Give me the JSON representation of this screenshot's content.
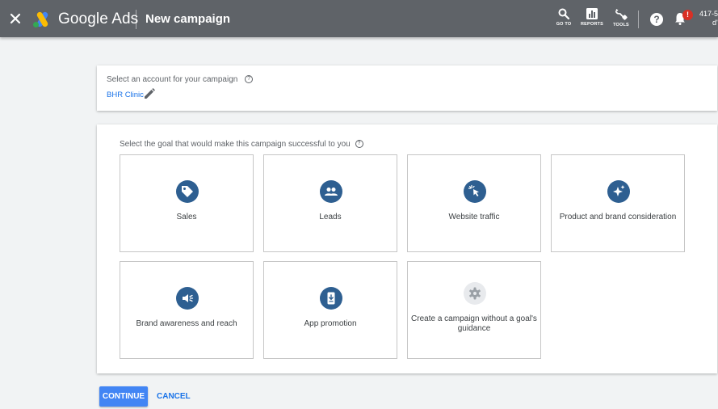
{
  "header": {
    "brand": "Google Ads",
    "title": "New campaign",
    "tools": [
      {
        "icon": "search-icon",
        "label": "GO TO"
      },
      {
        "icon": "reports-icon",
        "label": "REPORTS"
      },
      {
        "icon": "wrench-icon",
        "label": "TOOLS"
      }
    ],
    "help_glyph": "?",
    "notification_count": "!",
    "account_line1": "417-5",
    "account_line2": "d'"
  },
  "account_section": {
    "label": "Select an account for your campaign",
    "help_glyph": "?",
    "account_name": "BHR Clinic"
  },
  "goals_section": {
    "prompt": "Select the goal that would make this campaign successful to you",
    "help_glyph": "?",
    "goals": [
      {
        "label": "Sales",
        "icon": "tag-icon"
      },
      {
        "label": "Leads",
        "icon": "people-icon"
      },
      {
        "label": "Website traffic",
        "icon": "cursor-click-icon"
      },
      {
        "label": "Product and brand consideration",
        "icon": "sparkle-icon"
      },
      {
        "label": "Brand awareness and reach",
        "icon": "speaker-icon"
      },
      {
        "label": "App promotion",
        "icon": "phone-download-icon"
      },
      {
        "label": "Create a campaign without a goal's guidance",
        "icon": "gear-icon"
      }
    ]
  },
  "actions": {
    "continue_label": "CONTINUE",
    "cancel_label": "CANCEL"
  },
  "colors": {
    "header_bg": "#5f6368",
    "page_bg": "#f1f3f4",
    "goal_icon_bg": "#2e5f91",
    "primary_button": "#4285f4",
    "link": "#1a73e8",
    "badge": "#d93025"
  }
}
